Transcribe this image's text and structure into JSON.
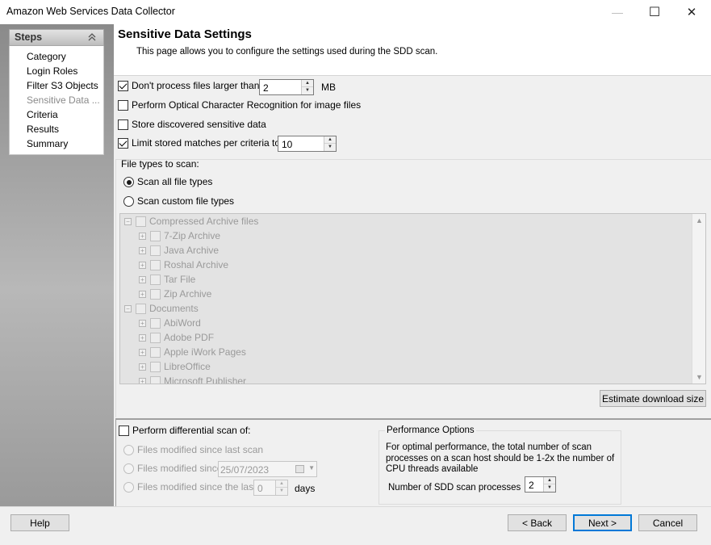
{
  "window": {
    "title": "Amazon Web Services Data Collector",
    "controls": {
      "minimize_icon": "—",
      "maximize_icon": "☐",
      "close_icon": "✕"
    }
  },
  "steps": {
    "title": "Steps",
    "collapse_icon": "⌃",
    "items": [
      {
        "label": "Category"
      },
      {
        "label": "Login Roles"
      },
      {
        "label": "Filter S3 Objects"
      },
      {
        "label": "Sensitive Data ...",
        "current": true
      },
      {
        "label": "Criteria"
      },
      {
        "label": "Results"
      },
      {
        "label": "Summary"
      }
    ]
  },
  "page": {
    "title": "Sensitive Data Settings",
    "description": "This page allows you to configure the settings used during the SDD scan."
  },
  "options": {
    "max_file_size": {
      "label": "Don't process files larger than",
      "checked": true,
      "value": "2",
      "unit": "MB"
    },
    "ocr": {
      "label": "Perform Optical Character Recognition for image files",
      "checked": false
    },
    "store_data": {
      "label": "Store discovered sensitive data",
      "checked": false
    },
    "limit_matches": {
      "label": "Limit stored matches per criteria to",
      "checked": true,
      "value": "10"
    }
  },
  "file_types": {
    "label": "File types to scan:",
    "scan_all": {
      "label": "Scan all file types",
      "selected": true
    },
    "scan_custom": {
      "label": "Scan custom file types",
      "selected": false
    },
    "tree": [
      {
        "label": "Compressed Archive files",
        "level": 0,
        "expander": "−"
      },
      {
        "label": "7-Zip Archive",
        "level": 1,
        "expander": "+"
      },
      {
        "label": "Java Archive",
        "level": 1,
        "expander": "+"
      },
      {
        "label": "Roshal Archive",
        "level": 1,
        "expander": "+"
      },
      {
        "label": "Tar File",
        "level": 1,
        "expander": "+"
      },
      {
        "label": "Zip Archive",
        "level": 1,
        "expander": "+"
      },
      {
        "label": "Documents",
        "level": 0,
        "expander": "−"
      },
      {
        "label": "AbiWord",
        "level": 1,
        "expander": "+"
      },
      {
        "label": "Adobe PDF",
        "level": 1,
        "expander": "+"
      },
      {
        "label": "Apple iWork Pages",
        "level": 1,
        "expander": "+"
      },
      {
        "label": "LibreOffice",
        "level": 1,
        "expander": "+"
      },
      {
        "label": "Microsoft Publisher",
        "level": 1,
        "expander": "+"
      }
    ],
    "scroll_up_icon": "▲",
    "scroll_down_icon": "▼",
    "estimate_button": "Estimate download size"
  },
  "differential": {
    "label": "Perform differential scan of:",
    "checked": false,
    "since_last_scan": "Files modified since last scan",
    "since_date": "Files modified since",
    "date_value": "25/07/2023",
    "since_last": "Files modified since the last",
    "days_value": "0",
    "days_unit": "days"
  },
  "performance": {
    "title": "Performance Options",
    "description": "For optimal performance, the total number of scan processes on a scan host should be 1-2x the number of CPU threads available",
    "processes_label": "Number of SDD scan processes",
    "processes_value": "2"
  },
  "footer": {
    "help": "Help",
    "back": "< Back",
    "next": "Next >",
    "cancel": "Cancel"
  }
}
